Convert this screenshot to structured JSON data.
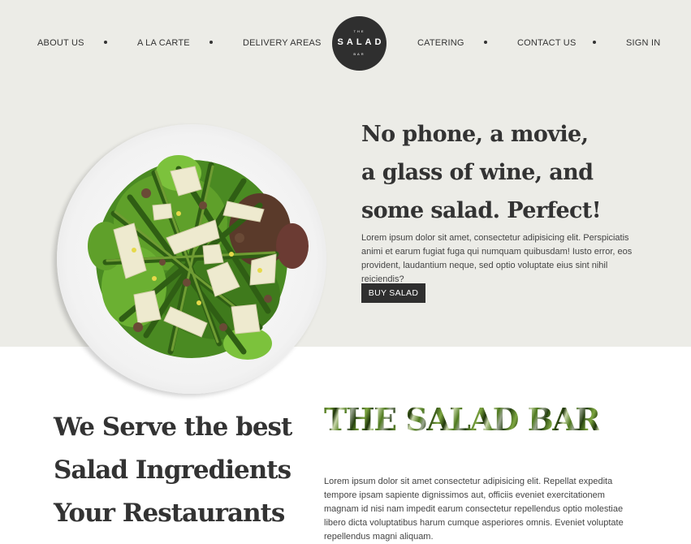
{
  "nav": {
    "left": [
      "ABOUT US",
      "A LA CARTE",
      "DELIVERY AREAS"
    ],
    "right": [
      "CATERING",
      "CONTACT US",
      "SIGN IN"
    ]
  },
  "logo": {
    "top": "THE",
    "main": "SALAD",
    "bottom": "BAR"
  },
  "hero": {
    "headline": [
      "No phone, a movie,",
      "a glass of wine, and",
      "some salad. Perfect!"
    ],
    "text": "Lorem ipsum dolor sit amet, consectetur adipisicing elit. Perspiciatis animi et earum fugiat fuga qui numquam quibusdam! Iusto error, eos provident, laudantium neque, sed optio voluptate eius sint nihil reiciendis?",
    "button": "BUY SALAD",
    "image_alt": "salad-plate"
  },
  "section2": {
    "heading": [
      "We Serve the best",
      "Salad Ingredients",
      "Your Restaurants"
    ],
    "brand": "THE SALAD BAR",
    "text": "Lorem ipsum dolor sit amet consectetur adipisicing elit. Repellat expedita tempore ipsam sapiente dignissimos aut, officiis eveniet exercitationem magnam id nisi nam impedit earum consectetur repellendus optio molestiae libero dicta voluptatibus harum cumque asperiores omnis. Eveniet voluptate repellendus magni aliquam."
  },
  "colors": {
    "hero_bg": "#ecece7",
    "dark": "#2f2f2f",
    "text": "#333333"
  }
}
